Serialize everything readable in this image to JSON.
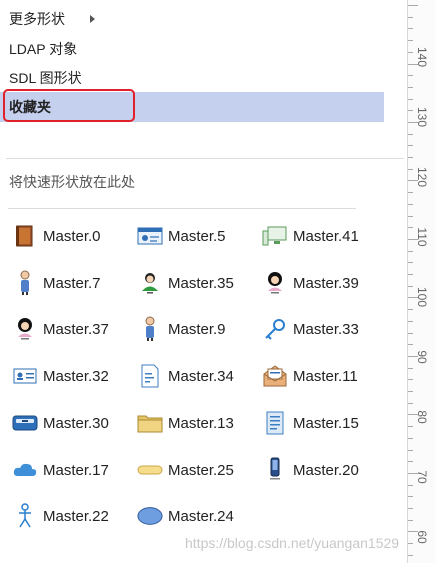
{
  "menu": {
    "more_shapes": "更多形状",
    "ldap": "LDAP 对象",
    "sdl": "SDL 图形状",
    "favorites": "收藏夹"
  },
  "drop_hint": "将快速形状放在此处",
  "shapes": [
    {
      "label": "Master.0",
      "icon": "book-icon"
    },
    {
      "label": "Master.5",
      "icon": "id-card-icon"
    },
    {
      "label": "Master.41",
      "icon": "computer-icon"
    },
    {
      "label": "Master.7",
      "icon": "person-icon"
    },
    {
      "label": "Master.35",
      "icon": "user-icon"
    },
    {
      "label": "Master.39",
      "icon": "user-female-icon"
    },
    {
      "label": "Master.37",
      "icon": "user-female-icon"
    },
    {
      "label": "Master.9",
      "icon": "person-icon"
    },
    {
      "label": "Master.33",
      "icon": "key-icon"
    },
    {
      "label": "Master.32",
      "icon": "contact-card-icon"
    },
    {
      "label": "Master.34",
      "icon": "document-icon"
    },
    {
      "label": "Master.11",
      "icon": "open-envelope-icon"
    },
    {
      "label": "Master.30",
      "icon": "disk-icon"
    },
    {
      "label": "Master.13",
      "icon": "folder-icon"
    },
    {
      "label": "Master.15",
      "icon": "document-lines-icon"
    },
    {
      "label": "Master.17",
      "icon": "cloud-icon"
    },
    {
      "label": "Master.25",
      "icon": "rounded-bar-icon"
    },
    {
      "label": "Master.20",
      "icon": "phone-icon"
    },
    {
      "label": "Master.22",
      "icon": "stick-figure-icon"
    },
    {
      "label": "Master.24",
      "icon": "ellipse-icon"
    }
  ],
  "ruler": {
    "labels": [
      "140",
      "130",
      "120",
      "110",
      "100",
      "90",
      "80",
      "70",
      "60"
    ]
  },
  "watermark": "https://blog.csdn.net/yuangan1529",
  "colors": {
    "selected_bg": "#c5d0ef",
    "highlight_border": "#e0202a"
  }
}
